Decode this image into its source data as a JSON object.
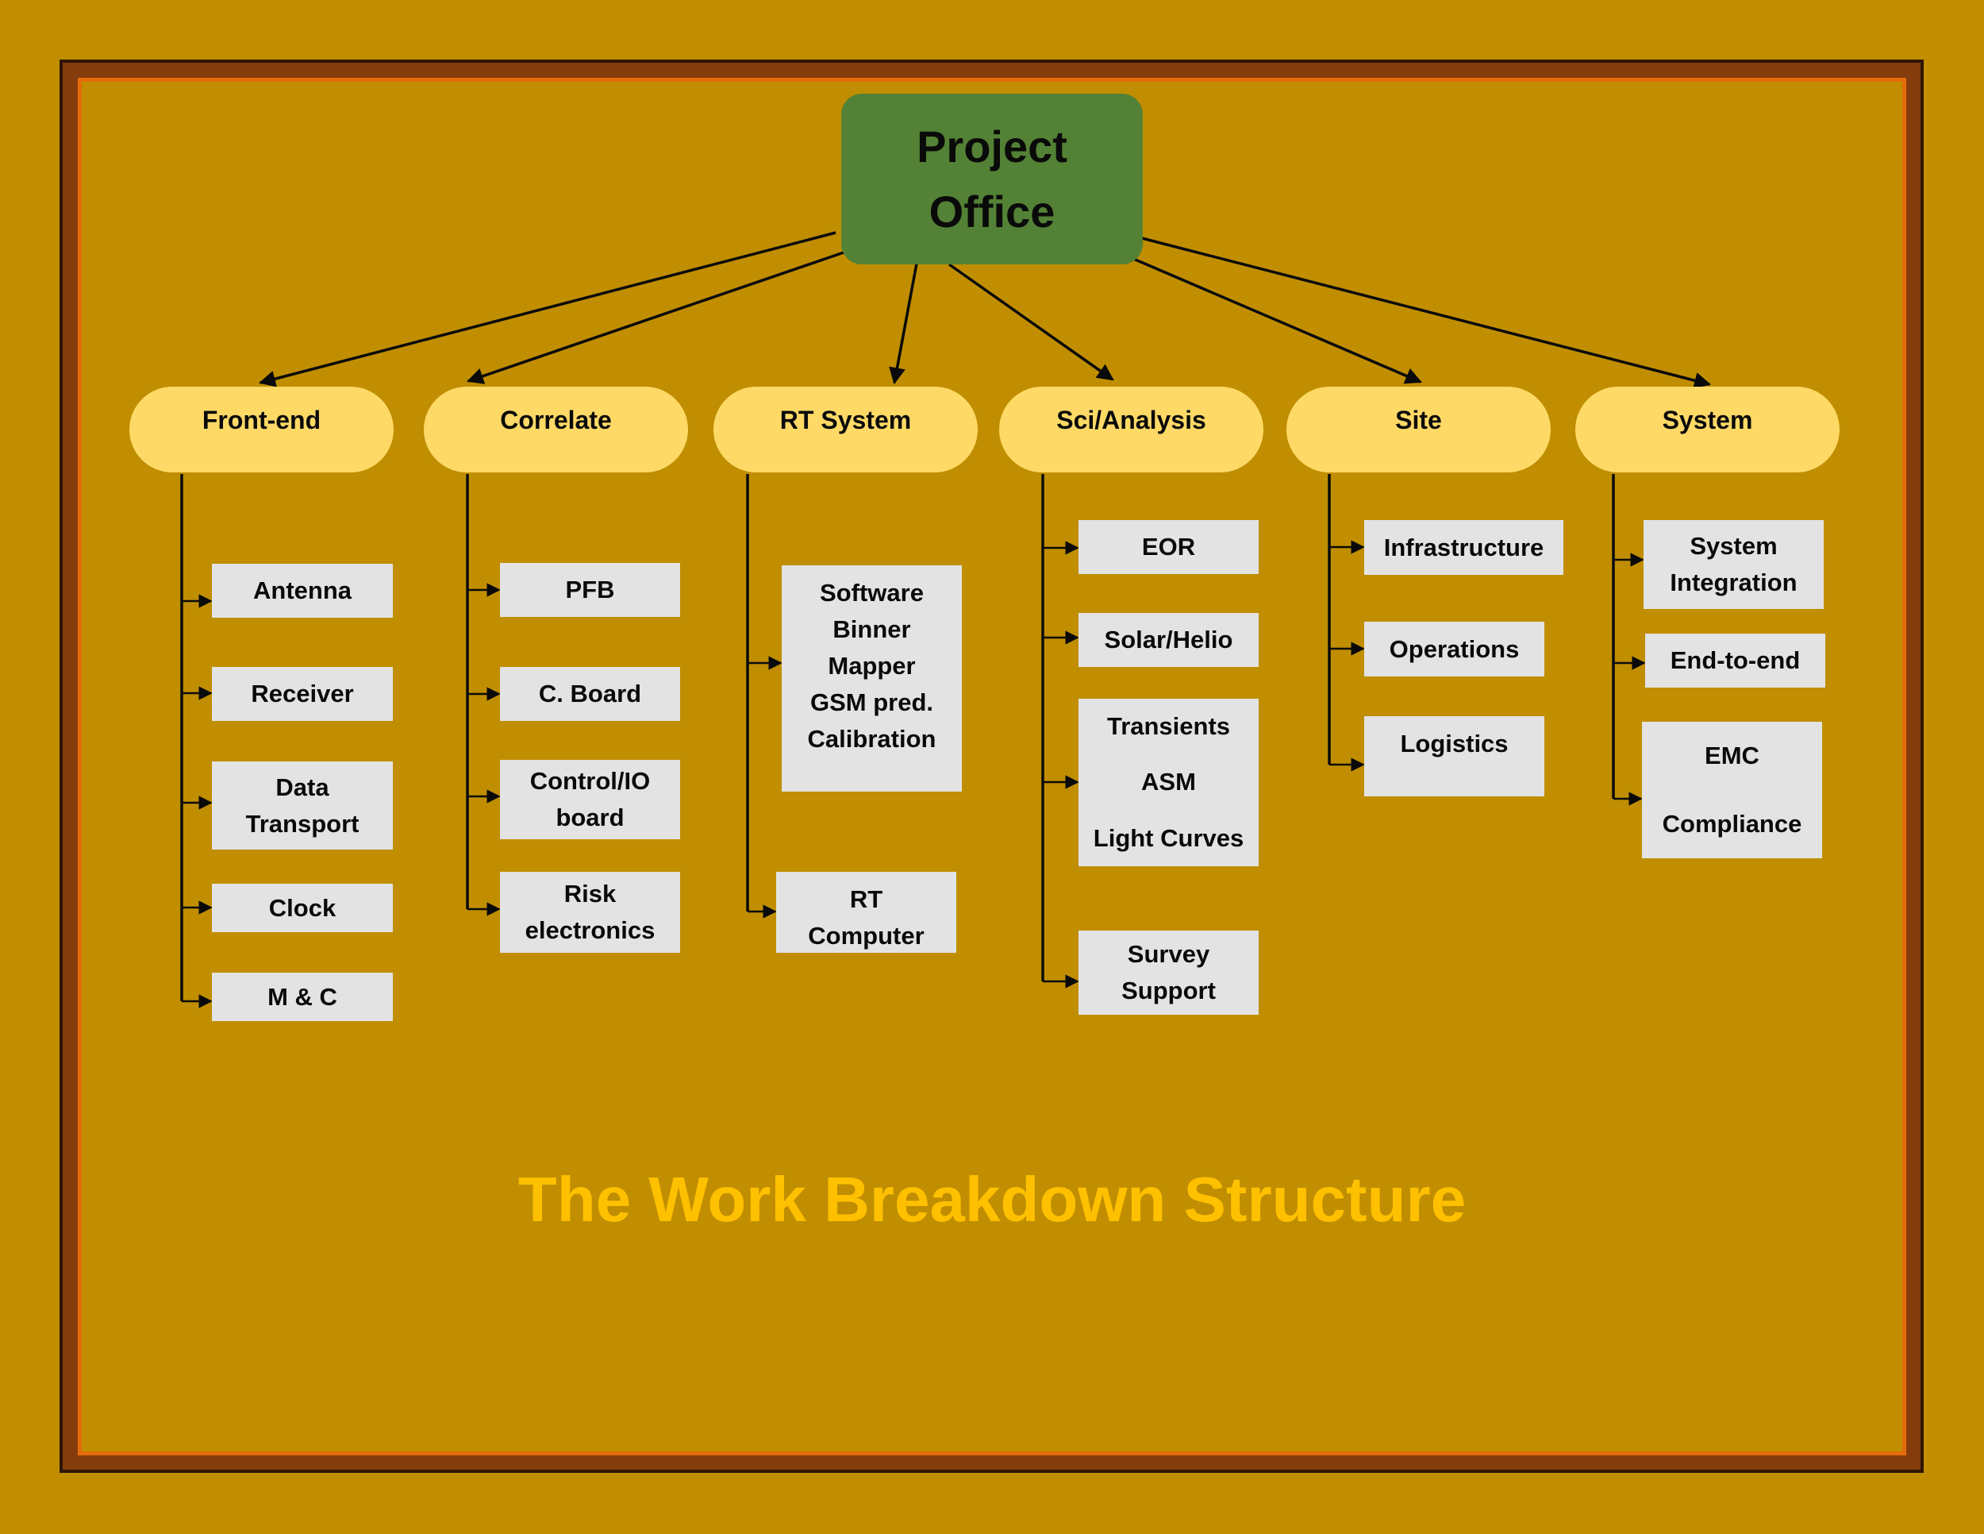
{
  "colors": {
    "background": "#C08E00",
    "frame_dark": "#2E1606",
    "frame_brown": "#843C0C",
    "frame_orange": "#E46C0A",
    "root_fill": "#538135",
    "category_fill": "#FFD966",
    "task_fill": "#E3E3E3",
    "title_color": "#FFC000",
    "connector": "#0A0A0A"
  },
  "root": {
    "lines": [
      "Project",
      "Office"
    ]
  },
  "categories": [
    {
      "label": "Front-end",
      "children": [
        {
          "lines": [
            "Antenna"
          ]
        },
        {
          "lines": [
            "Receiver"
          ]
        },
        {
          "lines": [
            "Data",
            "Transport"
          ]
        },
        {
          "lines": [
            "Clock"
          ]
        },
        {
          "lines": [
            "M & C"
          ]
        }
      ]
    },
    {
      "label": "Correlate",
      "children": [
        {
          "lines": [
            "PFB"
          ]
        },
        {
          "lines": [
            "C. Board"
          ]
        },
        {
          "lines": [
            "Control/IO",
            "board"
          ]
        },
        {
          "lines": [
            "Risk",
            "electronics"
          ]
        }
      ]
    },
    {
      "label": "RT System",
      "children": [
        {
          "lines": [
            "Software",
            "Binner",
            "Mapper",
            "GSM pred.",
            "Calibration"
          ]
        },
        {
          "lines": [
            "RT",
            "Computer"
          ]
        }
      ]
    },
    {
      "label": "Sci/Analysis",
      "children": [
        {
          "lines": [
            "EOR"
          ]
        },
        {
          "lines": [
            "Solar/Helio"
          ]
        },
        {
          "lines": [
            "Transients",
            "ASM",
            "Light Curves"
          ]
        },
        {
          "lines": [
            "Survey",
            "Support"
          ]
        }
      ]
    },
    {
      "label": "Site",
      "children": [
        {
          "lines": [
            "Infrastructure"
          ]
        },
        {
          "lines": [
            "Operations"
          ]
        },
        {
          "lines": [
            "Logistics"
          ]
        }
      ]
    },
    {
      "label": "System",
      "children": [
        {
          "lines": [
            "System",
            "Integration"
          ]
        },
        {
          "lines": [
            "End-to-end"
          ]
        },
        {
          "lines": [
            "EMC",
            "Compliance"
          ]
        }
      ]
    }
  ],
  "title": "The Work Breakdown Structure"
}
